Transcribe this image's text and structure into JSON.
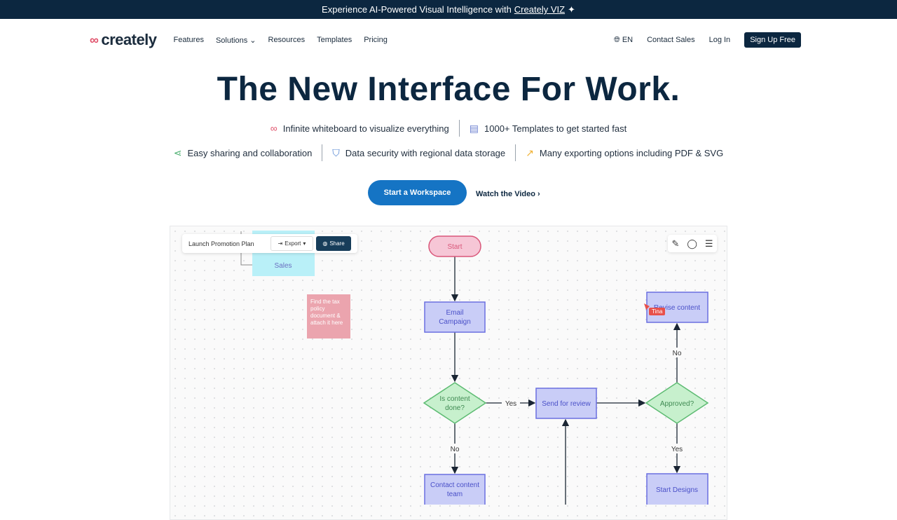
{
  "banner": {
    "text": "Experience AI-Powered Visual Intelligence with",
    "link": "Creately VIZ",
    "icon": "sparkle-icon"
  },
  "nav": {
    "logo": "creately",
    "links": [
      "Features",
      "Solutions",
      "Resources",
      "Templates",
      "Pricing"
    ],
    "lang": "EN",
    "contact": "Contact Sales",
    "login": "Log In",
    "signup": "Sign Up Free"
  },
  "hero": {
    "title": "The New Interface For Work.",
    "features_row1": [
      "Infinite whiteboard to visualize everything",
      "1000+ Templates to get started fast"
    ],
    "features_row2": [
      "Easy sharing and collaboration",
      "Data security with regional data storage",
      "Many exporting options including PDF & SVG"
    ],
    "cta": "Start a Workspace",
    "video": "Watch the Video"
  },
  "colors": {
    "brand": "#0c2740",
    "cta": "#1574c4",
    "process": "#c9cdf7",
    "decision": "#c7f0cd",
    "start": "#f6c6d6"
  },
  "board": {
    "doc_title": "Launch Promotion Plan",
    "export": "Export",
    "share": "Share",
    "sales": "Sales",
    "note": [
      "Find the tax",
      "policy",
      "document &",
      "attach it here"
    ],
    "cursor_user": "Tina",
    "nodes": {
      "start": "Start",
      "email": [
        "Email",
        "Campaign"
      ],
      "is_done": [
        "Is content",
        "done?"
      ],
      "review": "Send for review",
      "approved": "Approved?",
      "revise": "Revise content",
      "designs": "Start Designs",
      "contact": [
        "Contact content",
        "team"
      ]
    },
    "labels": {
      "yes1": "Yes",
      "no1": "No",
      "no2": "No",
      "yes2": "Yes"
    }
  }
}
